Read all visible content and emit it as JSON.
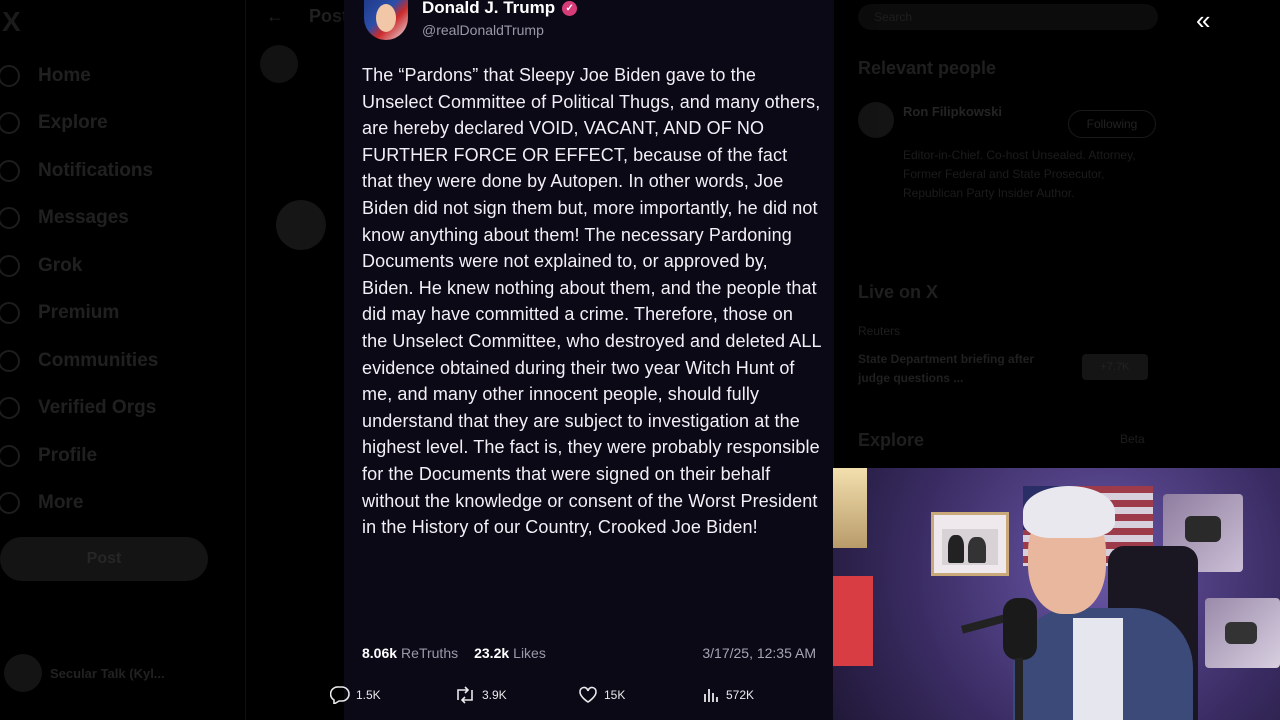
{
  "background": {
    "logo": "X",
    "nav_items": [
      {
        "label": "Home",
        "icon": "home-icon"
      },
      {
        "label": "Explore",
        "icon": "search-icon"
      },
      {
        "label": "Notifications",
        "icon": "bell-icon"
      },
      {
        "label": "Messages",
        "icon": "mail-icon"
      },
      {
        "label": "Grok",
        "icon": "grok-icon"
      },
      {
        "label": "Premium",
        "icon": "premium-icon"
      },
      {
        "label": "Communities",
        "icon": "communities-icon"
      },
      {
        "label": "Verified Orgs",
        "icon": "lightning-icon"
      },
      {
        "label": "Profile",
        "icon": "person-icon"
      },
      {
        "label": "More",
        "icon": "more-icon"
      }
    ],
    "post_button": "Post",
    "profile_name": "Secular Talk (Kyl...",
    "center_header": "Post",
    "right": {
      "search_placeholder": "Search",
      "relevant_people": "Relevant people",
      "person_name": "Ron Filipkowski",
      "following_label": "Following",
      "person_bio": "Editor-in-Chief. Co-host Unsealed. Attorney, Former Federal and State Prosecutor, Republican Party Insider Author.",
      "live_heading": "Live on X",
      "live_source": "Reuters",
      "live_title": "State Department briefing after judge questions ...",
      "live_count": "+7.7K",
      "explore_heading": "Explore",
      "explore_more": "Beta"
    }
  },
  "card": {
    "name": "Donald J. Trump",
    "handle": "@realDonaldTrump",
    "body": "The “Pardons” that Sleepy Joe Biden gave to the Unselect Committee of Political Thugs, and many others, are hereby declared VOID, VACANT, AND OF NO FURTHER FORCE OR EFFECT, because of the fact that they were done by Autopen. In other words, Joe Biden did not sign them but, more importantly, he did not know anything about them! The necessary Pardoning Documents were not explained to, or approved by, Biden. He knew nothing about them, and the people that did may have committed a crime. Therefore, those on the Unselect Committee, who destroyed and deleted ALL evidence obtained during their two year Witch Hunt of me, and many other innocent people, should fully understand that they are subject to investigation at the highest level. The fact is, they were probably responsible for the Documents that were signed on their behalf without the knowledge or consent of the Worst President in the History of our Country, Crooked Joe Biden!",
    "retruths_count": "8.06k",
    "retruths_label": "ReTruths",
    "likes_count": "23.2k",
    "likes_label": "Likes",
    "date": "3/17/25, 12:35 AM"
  },
  "actions": {
    "replies": "1.5K",
    "reposts": "3.9K",
    "likes": "15K",
    "views": "572K"
  },
  "colors": {
    "card_bg": "#0c0916",
    "verified": "#d63c78"
  }
}
